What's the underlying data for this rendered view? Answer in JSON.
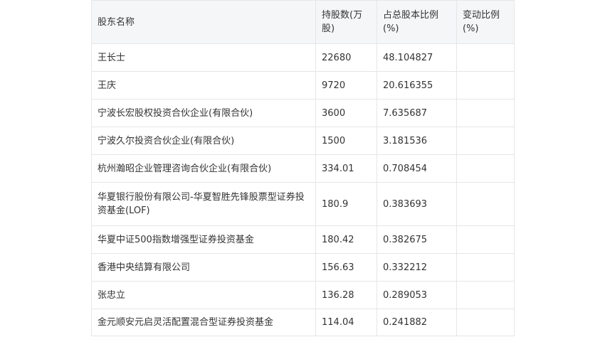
{
  "table": {
    "headers": [
      "股东名称",
      "持股数(万股)",
      "占总股本比例(%)",
      "变动比例(%)"
    ],
    "rows": [
      {
        "name": "王长士",
        "shares": "22680",
        "ratio": "48.104827",
        "change": ""
      },
      {
        "name": "王庆",
        "shares": "9720",
        "ratio": "20.616355",
        "change": ""
      },
      {
        "name": "宁波长宏股权投资合伙企业(有限合伙)",
        "shares": "3600",
        "ratio": "7.635687",
        "change": ""
      },
      {
        "name": "宁波久尔投资合伙企业(有限合伙)",
        "shares": "1500",
        "ratio": "3.181536",
        "change": ""
      },
      {
        "name": "杭州瀚昭企业管理咨询合伙企业(有限合伙)",
        "shares": "334.01",
        "ratio": "0.708454",
        "change": ""
      },
      {
        "name": "华夏银行股份有限公司-华夏智胜先锋股票型证券投资基金(LOF)",
        "shares": "180.9",
        "ratio": "0.383693",
        "change": ""
      },
      {
        "name": "华夏中证500指数增强型证券投资基金",
        "shares": "180.42",
        "ratio": "0.382675",
        "change": ""
      },
      {
        "name": "香港中央结算有限公司",
        "shares": "156.63",
        "ratio": "0.332212",
        "change": ""
      },
      {
        "name": "张忠立",
        "shares": "136.28",
        "ratio": "0.289053",
        "change": ""
      },
      {
        "name": "金元顺安元启灵活配置混合型证券投资基金",
        "shares": "114.04",
        "ratio": "0.241882",
        "change": ""
      }
    ]
  }
}
